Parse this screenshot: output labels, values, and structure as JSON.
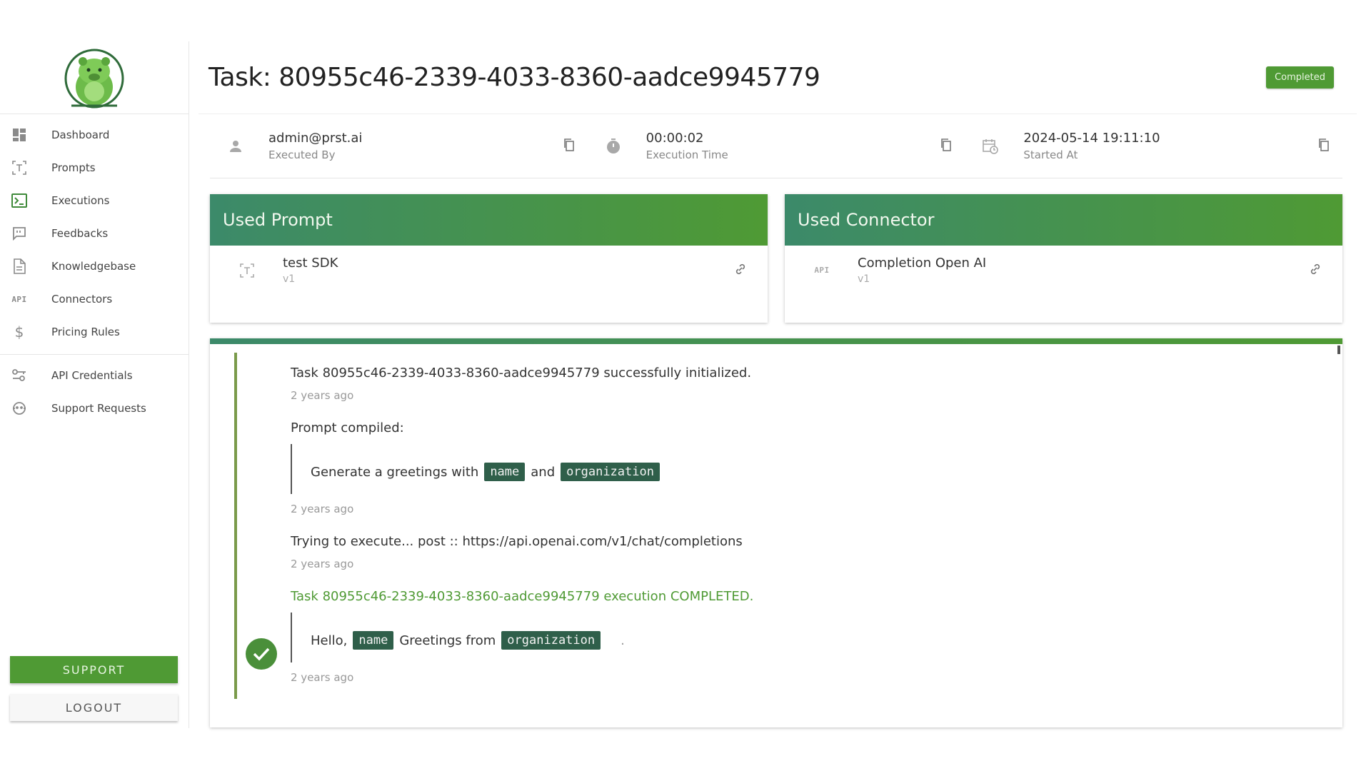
{
  "sidebar": {
    "items": [
      {
        "label": "Dashboard"
      },
      {
        "label": "Prompts"
      },
      {
        "label": "Executions"
      },
      {
        "label": "Feedbacks"
      },
      {
        "label": "Knowledgebase"
      },
      {
        "label": "Connectors",
        "icon_text": "API"
      },
      {
        "label": "Pricing Rules",
        "icon_text": "$"
      }
    ],
    "secondary_items": [
      {
        "label": "API Credentials"
      },
      {
        "label": "Support Requests"
      }
    ],
    "support_label": "SUPPORT",
    "logout_label": "LOGOUT"
  },
  "header": {
    "title": "Task: 80955c46-2339-4033-8360-aadce9945779",
    "status": "Completed"
  },
  "info": {
    "executed_by": {
      "value": "admin@prst.ai",
      "label": "Executed By"
    },
    "execution_time": {
      "value": "00:00:02",
      "label": "Execution Time"
    },
    "started_at": {
      "value": "2024-05-14 19:11:10",
      "label": "Started At"
    }
  },
  "prompt_card": {
    "title": "Used Prompt",
    "name": "test SDK",
    "version": "v1"
  },
  "connector_card": {
    "title": "Used Connector",
    "icon_text": "API",
    "name": "Completion Open AI",
    "version": "v1"
  },
  "timeline": {
    "entries": [
      {
        "message": "Task 80955c46-2339-4033-8360-aadce9945779 successfully initialized.",
        "time": "2 years ago"
      },
      {
        "message": "Prompt compiled:",
        "quote": {
          "text1": "Generate a greetings with",
          "tag1": "name",
          "text2": "and",
          "tag2": "organization"
        },
        "time": "2 years ago"
      },
      {
        "message": "Trying to execute... post :: https://api.openai.com/v1/chat/completions",
        "time": "2 years ago"
      },
      {
        "message_prefix": "Task 80955c46-2339-4033-8360-aadce9945779 execution",
        "message_status": "COMPLETED",
        "message_suffix": ".",
        "quote": {
          "text1": "Hello,",
          "tag1": "name",
          "text2": "Greetings from",
          "tag2": "organization",
          "text3": "."
        },
        "time": "2 years ago"
      }
    ]
  },
  "colors": {
    "accent": "#4f9a34",
    "header_gradient_start": "#3c8a6a",
    "tag_bg": "#2f5f4a"
  }
}
